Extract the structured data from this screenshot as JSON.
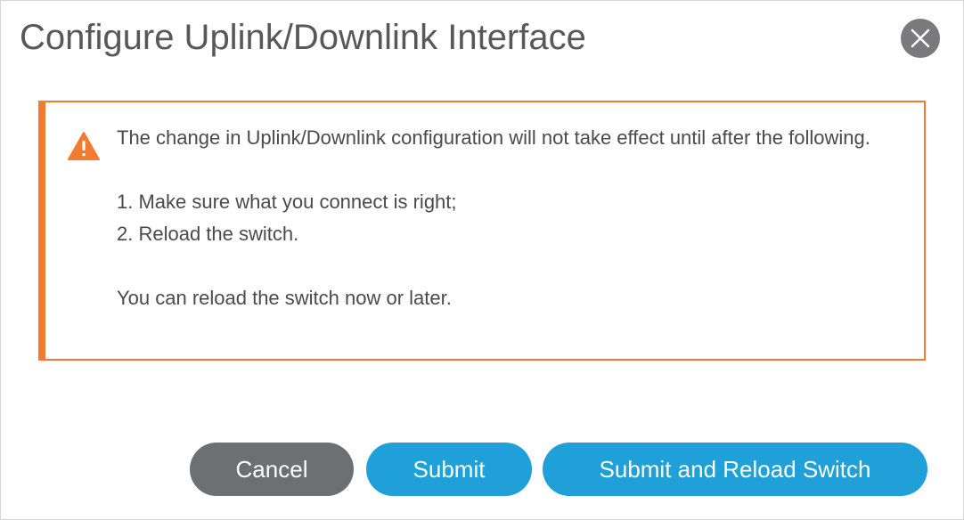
{
  "dialog": {
    "title": "Configure Uplink/Downlink Interface",
    "close_icon": "close-icon"
  },
  "alert": {
    "icon": "warning-icon",
    "accent_color": "#f47a32",
    "message_line1": "The change in Uplink/Downlink configuration will not take effect until after the following.",
    "steps": [
      "1. Make sure what you connect is right;",
      "2. Reload the switch."
    ],
    "footer_note": "You can reload the switch now or later."
  },
  "buttons": {
    "cancel_label": "Cancel",
    "submit_label": "Submit",
    "submit_reload_label": "Submit and Reload Switch"
  },
  "colors": {
    "primary": "#1fa0d8",
    "secondary": "#6e6f72",
    "warning": "#f47a32"
  }
}
